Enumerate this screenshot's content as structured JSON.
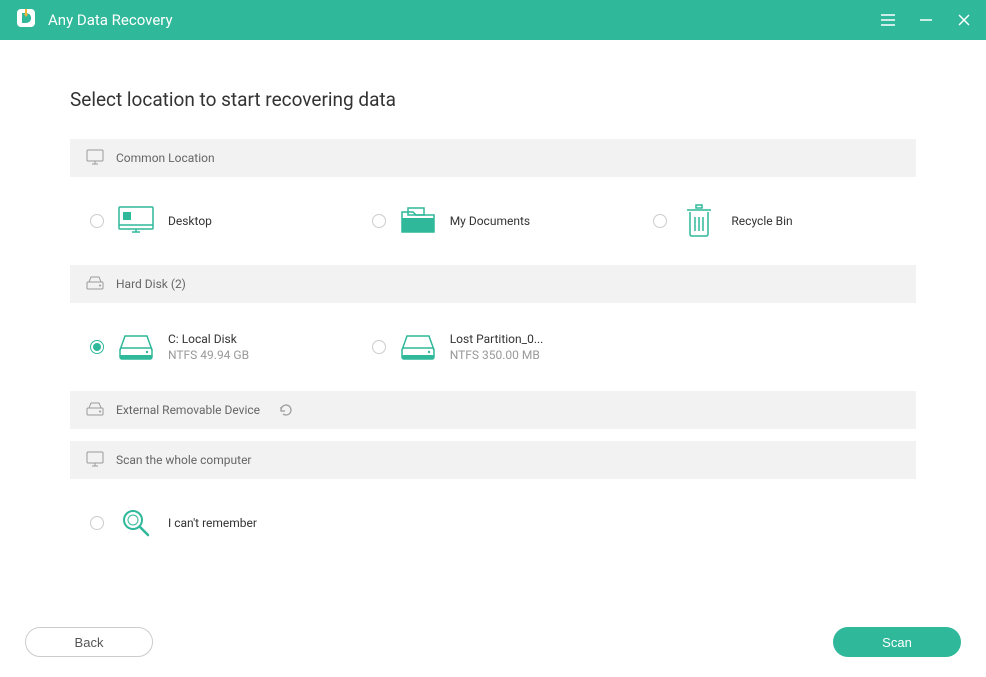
{
  "titlebar": {
    "app_name": "Any Data Recovery"
  },
  "page_title": "Select location to start recovering data",
  "sections": {
    "common": {
      "header": "Common Location"
    },
    "hard_disk": {
      "header": "Hard Disk (2)"
    },
    "external": {
      "header": "External Removable Device"
    },
    "whole": {
      "header": "Scan the whole computer"
    }
  },
  "options": {
    "desktop": {
      "label": "Desktop"
    },
    "documents": {
      "label": "My Documents"
    },
    "recycle": {
      "label": "Recycle Bin"
    },
    "c_drive": {
      "label": "C: Local Disk",
      "sub": "NTFS  49.94 GB"
    },
    "lost_partition": {
      "label": "Lost Partition_0...",
      "sub": "NTFS  350.00 MB"
    },
    "remember": {
      "label": "I can't remember"
    }
  },
  "buttons": {
    "back": "Back",
    "scan": "Scan"
  },
  "colors": {
    "accent": "#2fb89a"
  }
}
